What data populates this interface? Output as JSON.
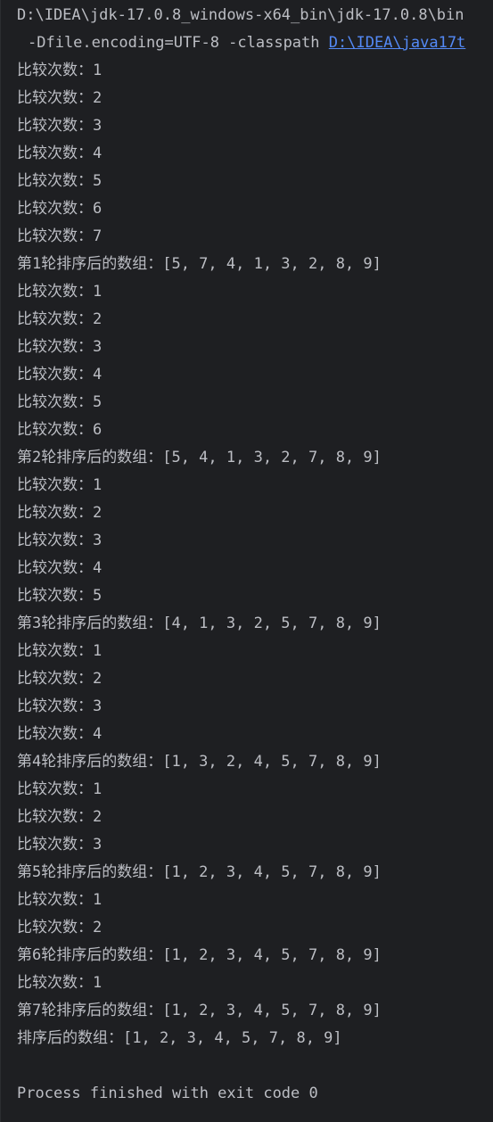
{
  "command": {
    "line1": "D:\\IDEA\\jdk-17.0.8_windows-x64_bin\\jdk-17.0.8\\bin",
    "line2_prefix": "-Dfile.encoding=UTF-8 -classpath ",
    "line2_link": "D:\\IDEA\\java17t"
  },
  "output": [
    "比较次数：1",
    "比较次数：2",
    "比较次数：3",
    "比较次数：4",
    "比较次数：5",
    "比较次数：6",
    "比较次数：7",
    "第1轮排序后的数组：[5, 7, 4, 1, 3, 2, 8, 9]",
    "比较次数：1",
    "比较次数：2",
    "比较次数：3",
    "比较次数：4",
    "比较次数：5",
    "比较次数：6",
    "第2轮排序后的数组：[5, 4, 1, 3, 2, 7, 8, 9]",
    "比较次数：1",
    "比较次数：2",
    "比较次数：3",
    "比较次数：4",
    "比较次数：5",
    "第3轮排序后的数组：[4, 1, 3, 2, 5, 7, 8, 9]",
    "比较次数：1",
    "比较次数：2",
    "比较次数：3",
    "比较次数：4",
    "第4轮排序后的数组：[1, 3, 2, 4, 5, 7, 8, 9]",
    "比较次数：1",
    "比较次数：2",
    "比较次数：3",
    "第5轮排序后的数组：[1, 2, 3, 4, 5, 7, 8, 9]",
    "比较次数：1",
    "比较次数：2",
    "第6轮排序后的数组：[1, 2, 3, 4, 5, 7, 8, 9]",
    "比较次数：1",
    "第7轮排序后的数组：[1, 2, 3, 4, 5, 7, 8, 9]",
    "排序后的数组：[1, 2, 3, 4, 5, 7, 8, 9]"
  ],
  "exit_message": "Process finished with exit code 0",
  "colors": {
    "background": "#1e1f22",
    "text": "#bcbec4",
    "link": "#548af7"
  }
}
